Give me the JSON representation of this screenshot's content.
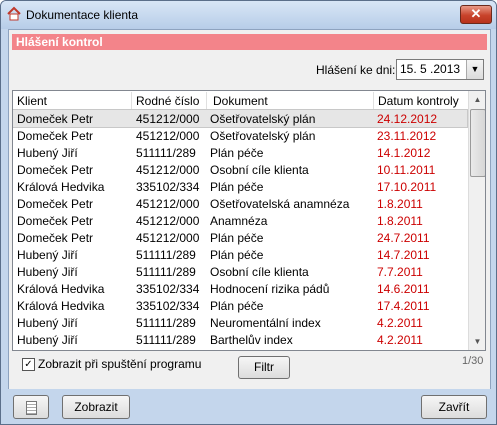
{
  "window": {
    "title": "Dokumentace klienta",
    "close_glyph": "✕"
  },
  "header": {
    "title": "Hlášení kontrol"
  },
  "date_filter": {
    "label": "Hlášení ke dni:",
    "value": "15. 5 .2013"
  },
  "table": {
    "columns": [
      "Klient",
      "Rodné číslo",
      "Dokument",
      "Datum kontroly"
    ],
    "rows": [
      [
        "Domeček Petr",
        "451212/000",
        "Ošetřovatelský plán",
        "24.12.2012"
      ],
      [
        "Domeček Petr",
        "451212/000",
        "Ošetřovatelský plán",
        "23.11.2012"
      ],
      [
        "Hubený Jiří",
        "511111/289",
        "Plán péče",
        "14.1.2012"
      ],
      [
        "Domeček Petr",
        "451212/000",
        "Osobní cíle klienta",
        "10.11.2011"
      ],
      [
        "Králová Hedvika",
        "335102/334",
        "Plán péče",
        "17.10.2011"
      ],
      [
        "Domeček Petr",
        "451212/000",
        "Ošetřovatelská anamnéza",
        "1.8.2011"
      ],
      [
        "Domeček Petr",
        "451212/000",
        "Anamnéza",
        "1.8.2011"
      ],
      [
        "Domeček Petr",
        "451212/000",
        "Plán péče",
        "24.7.2011"
      ],
      [
        "Hubený Jiří",
        "511111/289",
        "Plán péče",
        "14.7.2011"
      ],
      [
        "Hubený Jiří",
        "511111/289",
        "Osobní cíle klienta",
        "7.7.2011"
      ],
      [
        "Králová Hedvika",
        "335102/334",
        "Hodnocení rizika pádů",
        "14.6.2011"
      ],
      [
        "Králová Hedvika",
        "335102/334",
        "Plán péče",
        "17.4.2011"
      ],
      [
        "Hubený Jiří",
        "511111/289",
        "Neuromentální index",
        "4.2.2011"
      ],
      [
        "Hubený Jiří",
        "511111/289",
        "Barthelův index",
        "4.2.2011"
      ]
    ],
    "date_color": "#cc0000"
  },
  "options": {
    "show_on_start_label": "Zobrazit při spuštění programu",
    "show_on_start_checked": true,
    "filter_label": "Filtr",
    "counter": "1/30"
  },
  "footer": {
    "show_label": "Zobrazit",
    "close_label": "Zavřít"
  },
  "colors": {
    "header_bar": "#f3848a",
    "window_frame": "#c4d6ec"
  }
}
